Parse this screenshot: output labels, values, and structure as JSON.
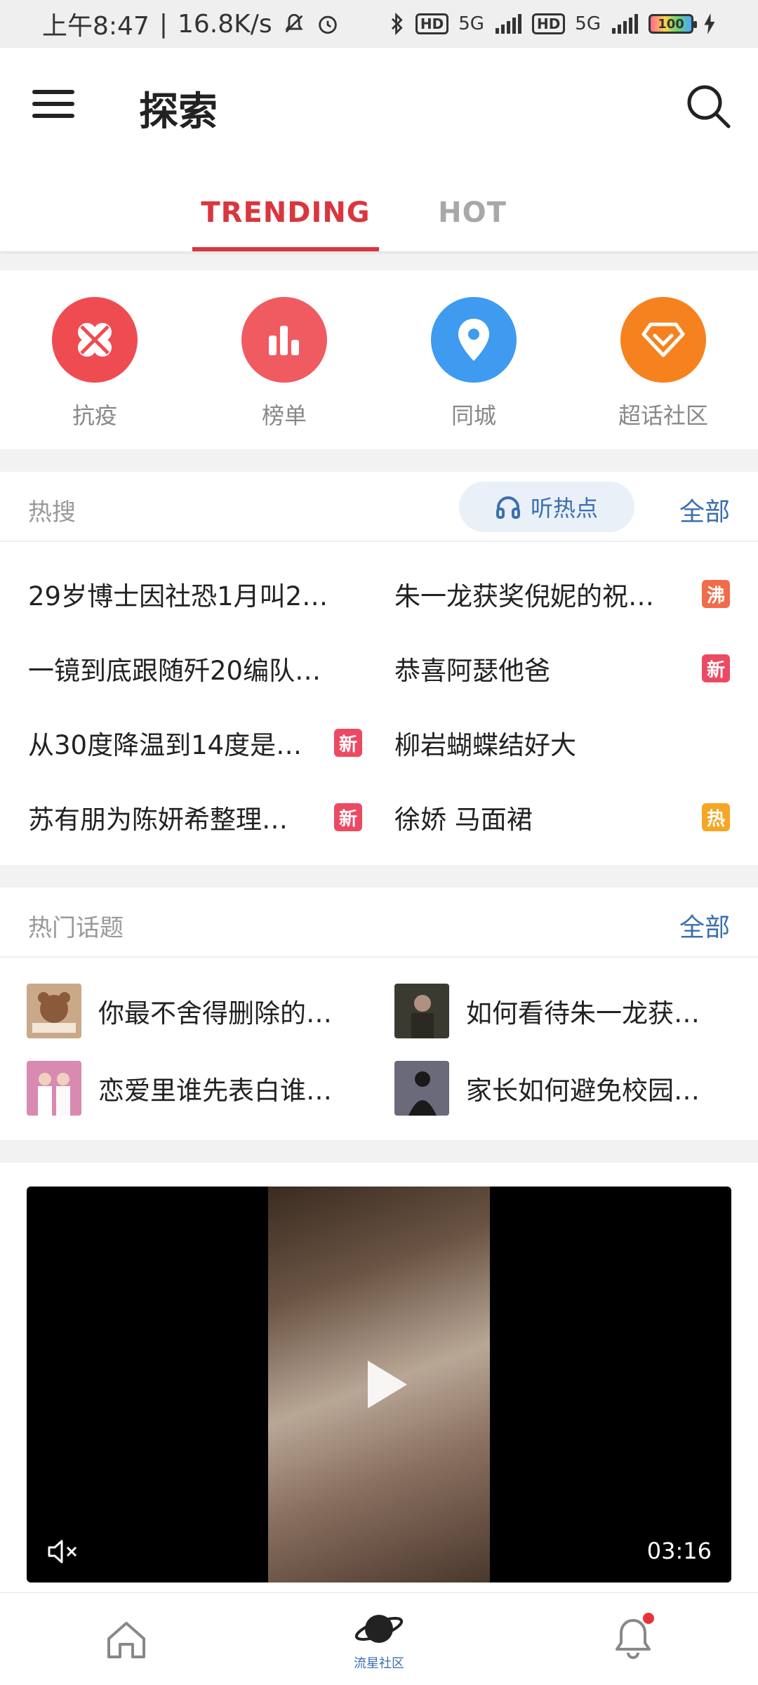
{
  "status_bar": {
    "time": "上午8:47",
    "network_speed": "16.8K/s",
    "battery": "100",
    "hd_label": "HD",
    "signal_label": "5G"
  },
  "header": {
    "title": "探索",
    "tabs": [
      {
        "label": "TRENDING",
        "active": true
      },
      {
        "label": "HOT",
        "active": false
      }
    ]
  },
  "shortcuts": [
    {
      "label": "抗疫",
      "icon": "clover-icon",
      "color": "#ef4c52"
    },
    {
      "label": "榜单",
      "icon": "bar-chart-icon",
      "color": "#ef5b61"
    },
    {
      "label": "同城",
      "icon": "location-pin-icon",
      "color": "#3e9bf0"
    },
    {
      "label": "超话社区",
      "icon": "diamond-icon",
      "color": "#f5821f"
    }
  ],
  "hot_search": {
    "title": "热搜",
    "listen_label": "听热点",
    "see_all": "全部",
    "items": [
      {
        "text": "29岁博士因社恐1月叫2…",
        "badge": ""
      },
      {
        "text": "朱一龙获奖倪妮的祝…",
        "badge": "沸"
      },
      {
        "text": "一镜到底跟随歼20编队…",
        "badge": ""
      },
      {
        "text": "恭喜阿瑟他爸",
        "badge": "新"
      },
      {
        "text": "从30度降温到14度是…",
        "badge": "新"
      },
      {
        "text": "柳岩蝴蝶结好大",
        "badge": ""
      },
      {
        "text": "苏有朋为陈妍希整理…",
        "badge": "新"
      },
      {
        "text": "徐娇 马面裙",
        "badge": "热"
      }
    ]
  },
  "hot_topics": {
    "title": "热门话题",
    "see_all": "全部",
    "items": [
      {
        "text": "你最不舍得删除的…"
      },
      {
        "text": "如何看待朱一龙获…"
      },
      {
        "text": "恋爱里谁先表白谁…"
      },
      {
        "text": "家长如何避免校园…"
      }
    ]
  },
  "video": {
    "duration": "03:16"
  },
  "bottom_nav": {
    "items": [
      {
        "icon": "home-icon",
        "label": ""
      },
      {
        "icon": "planet-icon",
        "label": "流星社区"
      },
      {
        "icon": "bell-icon",
        "label": ""
      }
    ]
  },
  "colors": {
    "accent_red": "#d9363e",
    "link_blue": "#3b6fb0"
  }
}
